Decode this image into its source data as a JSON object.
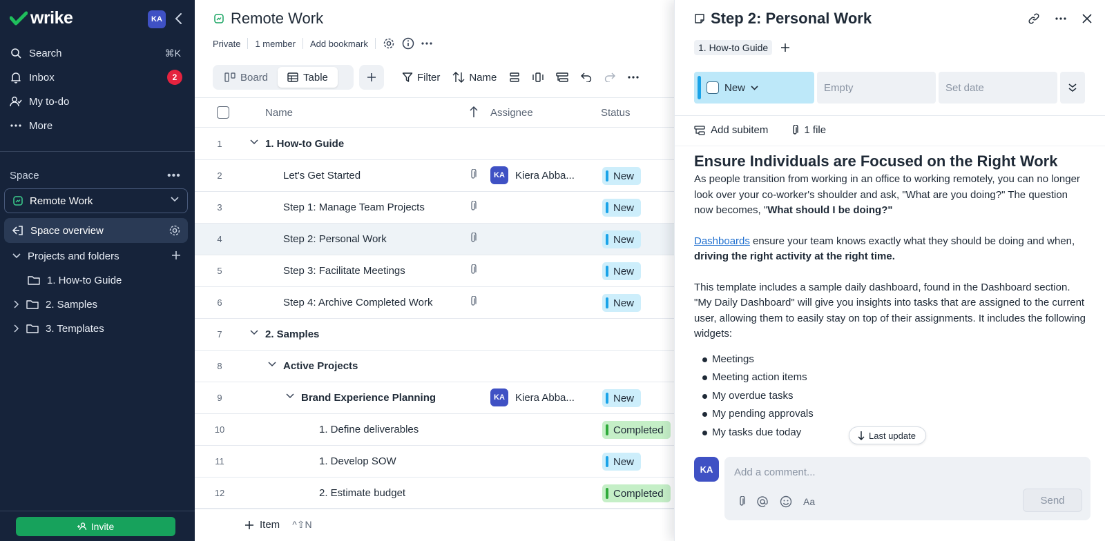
{
  "sidebar": {
    "brand": "wrike",
    "avatar": "KA",
    "nav": [
      {
        "label": "Search",
        "shortcut": "⌘K"
      },
      {
        "label": "Inbox",
        "badge": "2"
      },
      {
        "label": "My to-do"
      },
      {
        "label": "More"
      }
    ],
    "space_label": "Space",
    "space_select": "Remote Work",
    "space_overview": "Space overview",
    "projects_label": "Projects and folders",
    "folders": [
      "1. How-to Guide",
      "2. Samples",
      "3. Templates"
    ],
    "invite": "Invite"
  },
  "main": {
    "title": "Remote Work",
    "meta": [
      "Private",
      "1 member",
      "Add bookmark"
    ],
    "views": [
      "Board",
      "Table"
    ],
    "active_view": "Table",
    "filter": "Filter",
    "sort": "Name",
    "columns": {
      "name": "Name",
      "assignee": "Assignee",
      "status": "Status"
    },
    "rows": [
      {
        "num": "1",
        "name": "1. How-to Guide",
        "level": 0,
        "group": true,
        "assignee": "",
        "status": ""
      },
      {
        "num": "2",
        "name": "Let's Get Started",
        "level": 1,
        "group": false,
        "clip": true,
        "assignee": "Kiera Abba...",
        "status": "New"
      },
      {
        "num": "3",
        "name": "Step 1: Manage Team Projects",
        "level": 1,
        "group": false,
        "clip": true,
        "assignee": "",
        "status": "New"
      },
      {
        "num": "4",
        "name": "Step 2: Personal Work",
        "level": 1,
        "group": false,
        "clip": true,
        "assignee": "",
        "status": "New",
        "selected": true
      },
      {
        "num": "5",
        "name": "Step 3: Facilitate Meetings",
        "level": 1,
        "group": false,
        "clip": true,
        "assignee": "",
        "status": "New"
      },
      {
        "num": "6",
        "name": "Step 4: Archive Completed Work",
        "level": 1,
        "group": false,
        "clip": true,
        "assignee": "",
        "status": "New"
      },
      {
        "num": "7",
        "name": "2. Samples",
        "level": 0,
        "group": true,
        "assignee": "",
        "status": ""
      },
      {
        "num": "8",
        "name": "Active Projects",
        "level": 1,
        "group": true,
        "assignee": "",
        "status": ""
      },
      {
        "num": "9",
        "name": "Brand Experience Planning",
        "level": 2,
        "group": true,
        "assignee": "Kiera Abba...",
        "status": "New"
      },
      {
        "num": "10",
        "name": "1. Define deliverables",
        "level": 3,
        "group": false,
        "assignee": "",
        "status": "Completed"
      },
      {
        "num": "11",
        "name": "1. Develop SOW",
        "level": 3,
        "group": false,
        "assignee": "",
        "status": "New"
      },
      {
        "num": "12",
        "name": "2. Estimate budget",
        "level": 3,
        "group": false,
        "assignee": "",
        "status": "Completed"
      }
    ],
    "assignee_initials": "KA",
    "footer_item": "Item",
    "footer_shortcut": "^⇧N"
  },
  "panel": {
    "title": "Step 2: Personal Work",
    "tag": "1. How-to Guide",
    "status": "New",
    "assignee_placeholder": "Empty",
    "date_placeholder": "Set date",
    "add_subitem": "Add subitem",
    "files": "1 file",
    "heading": "Ensure Individuals are Focused on the Right Work",
    "p1_a": "As people transition from working in an office to working remotely, you can no longer look over your co-worker's shoulder and ask, \"What are you doing?\" The question now becomes, \"",
    "p1_b": "What should I be doing?\"",
    "p2_link": "Dashboards",
    "p2_a": " ensure your team knows exactly what they should be doing and when, ",
    "p2_b": "driving the right activity at the right time.",
    "p3": "This template includes a sample daily dashboard, found in the Dashboard section. \"My Daily Dashboard\" will give you insights into tasks that are assigned to the current user, allowing them to easily stay on top of their assignments. It includes the following widgets:",
    "bullets": [
      "Meetings",
      "Meeting action items",
      "My overdue tasks",
      "My pending approvals",
      "My tasks due today"
    ],
    "last_update": "Last update",
    "comment_avatar": "KA",
    "comment_placeholder": "Add a comment...",
    "format_label": "Aa",
    "send": "Send"
  }
}
